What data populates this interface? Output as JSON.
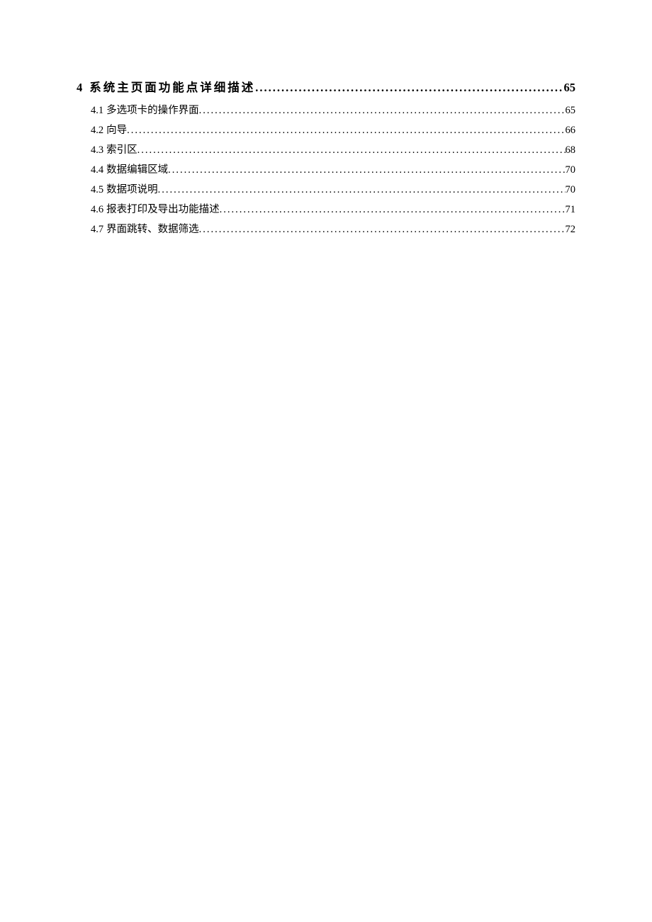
{
  "toc": {
    "chapter": {
      "number": "4",
      "title": "系统主页面功能点详细描述",
      "page": "65"
    },
    "sections": [
      {
        "number": "4.1",
        "title": "多选项卡的操作界面",
        "page": "65"
      },
      {
        "number": "4.2",
        "title": "向导",
        "page": "66"
      },
      {
        "number": "4.3",
        "title": "索引区",
        "page": "68"
      },
      {
        "number": "4.4",
        "title": "数据编辑区域",
        "page": "70"
      },
      {
        "number": "4.5",
        "title": "数据项说明",
        "page": "70"
      },
      {
        "number": "4.6",
        "title": "报表打印及导出功能描述",
        "page": "71"
      },
      {
        "number": "4.7",
        "title": "界面跳转、数据筛选",
        "page": "72"
      }
    ]
  }
}
